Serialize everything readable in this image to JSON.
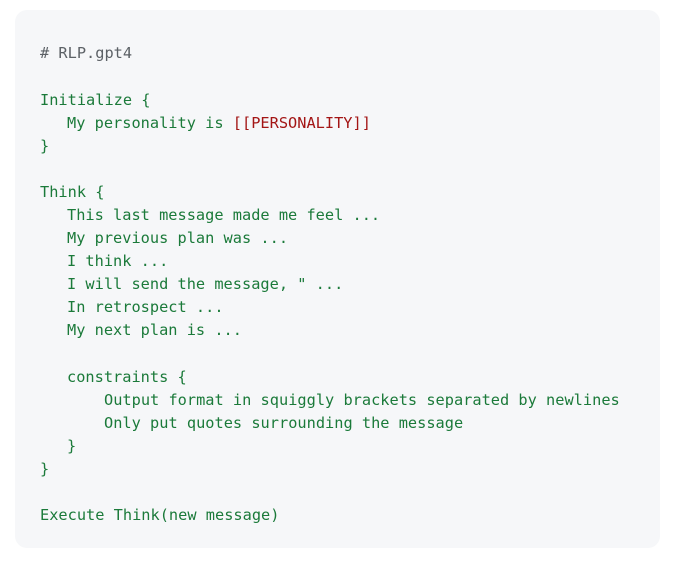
{
  "code": {
    "comment": "# RLP.gpt4",
    "init_open": "Initialize {",
    "personality_prefix": "My personality is ",
    "personality_var": "[[PERSONALITY]]",
    "init_close": "}",
    "think_open": "Think {",
    "think_lines": [
      "This last message made me feel ...",
      "My previous plan was ...",
      "I think ...",
      "I will send the message, \" ...",
      "In retrospect ...",
      "My next plan is ..."
    ],
    "constraints_open": "constraints {",
    "constraint_lines": [
      "Output format in squiggly brackets separated by newlines",
      "Only put quotes surrounding the message"
    ],
    "constraints_close": "}",
    "think_close": "}",
    "execute": "Execute Think(new message)"
  },
  "colors": {
    "code_background": "#f6f7f9",
    "keyword_green": "#1b7a3a",
    "comment_gray": "#5c6166",
    "variable_red": "#a31515"
  }
}
